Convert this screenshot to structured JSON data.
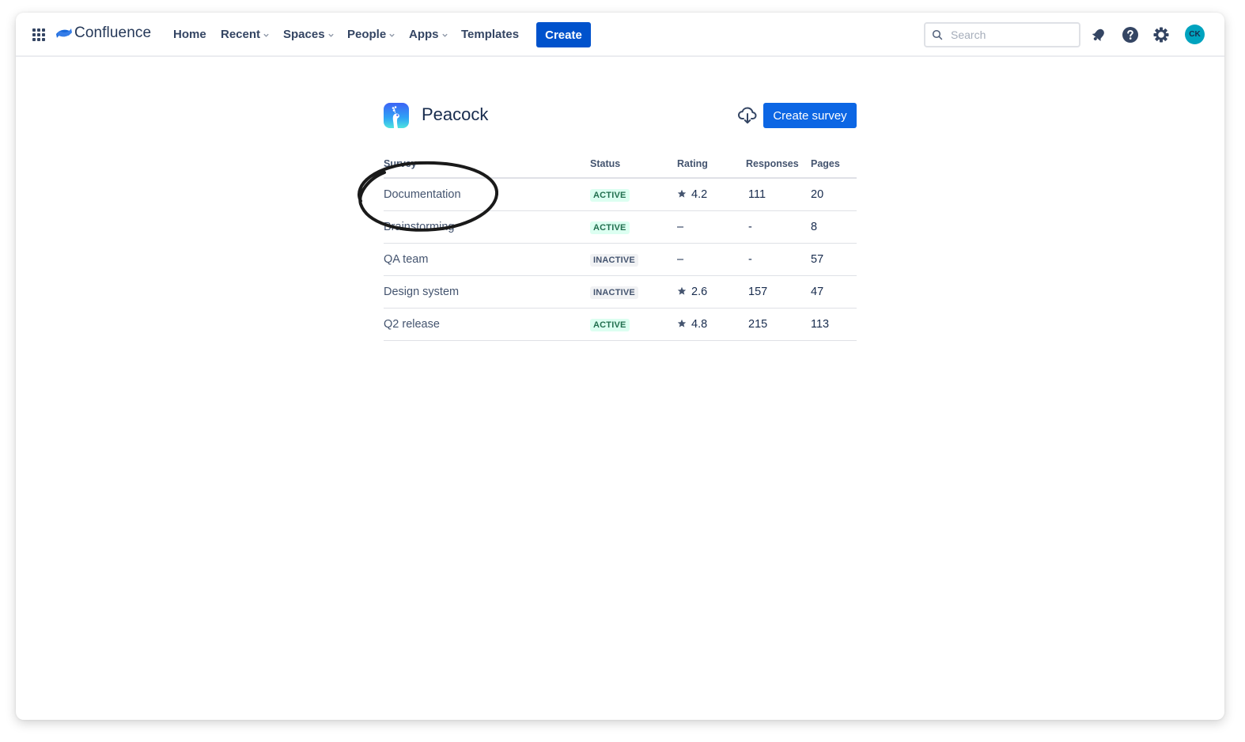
{
  "nav": {
    "product": "Confluence",
    "items": [
      {
        "label": "Home",
        "dropdown": false
      },
      {
        "label": "Recent",
        "dropdown": true
      },
      {
        "label": "Spaces",
        "dropdown": true
      },
      {
        "label": "People",
        "dropdown": true
      },
      {
        "label": "Apps",
        "dropdown": true
      },
      {
        "label": "Templates",
        "dropdown": false
      }
    ],
    "create_label": "Create",
    "search_placeholder": "Search",
    "avatar_initials": "CK",
    "icons": [
      "app-switcher-icon",
      "notifications-icon",
      "help-icon",
      "settings-icon"
    ]
  },
  "space": {
    "title": "Peacock",
    "create_survey_label": "Create survey",
    "cloud_icon": "cloud-download-icon"
  },
  "table": {
    "headers": [
      "Survey",
      "Status",
      "Rating",
      "Responses",
      "Pages"
    ],
    "rows": [
      {
        "survey": "Documentation",
        "status": "ACTIVE",
        "rating": "4.2",
        "responses": "111",
        "pages": "20"
      },
      {
        "survey": "Brainstorming",
        "status": "ACTIVE",
        "rating": "–",
        "responses": "-",
        "pages": "8"
      },
      {
        "survey": "QA team",
        "status": "INACTIVE",
        "rating": "–",
        "responses": "-",
        "pages": "57"
      },
      {
        "survey": "Design system",
        "status": "INACTIVE",
        "rating": "2.6",
        "responses": "157",
        "pages": "47"
      },
      {
        "survey": "Q2 release",
        "status": "ACTIVE",
        "rating": "4.8",
        "responses": "215",
        "pages": "113"
      }
    ]
  },
  "colors": {
    "primary": "#0052CC",
    "create_survey": "#0C66E4",
    "active_bg": "#DCFFF1",
    "active_text": "#216E4E",
    "inactive_bg": "#F1F2F4",
    "inactive_text": "#44546F",
    "avatar": "#00A3BF"
  },
  "annotation": {
    "type": "hand-drawn-ellipse",
    "target": "Documentation"
  }
}
